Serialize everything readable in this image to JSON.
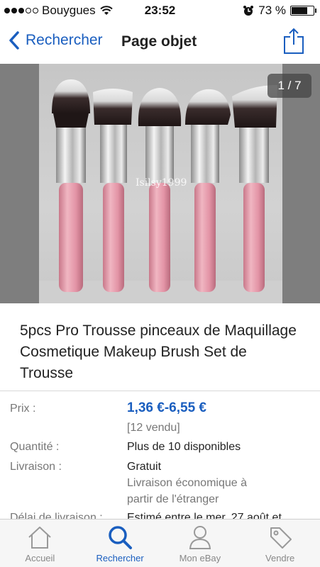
{
  "status_bar": {
    "carrier": "Bouygues",
    "time": "23:52",
    "battery_text": "73 %",
    "battery_level": 0.73
  },
  "nav": {
    "back_label": "Rechercher",
    "title": "Page objet",
    "share_icon": "share-icon"
  },
  "gallery": {
    "counter": "1 / 7",
    "watermark": "Isilsy1999"
  },
  "item": {
    "title": "5pcs Pro Trousse pinceaux de Maquillage Cosmetique Makeup Brush Set de Trousse"
  },
  "details": {
    "price_label": "Prix :",
    "price_value": "1,36 €-6,55 €",
    "sold": "[12 vendu]",
    "quantity_label": "Quantité :",
    "quantity_value": "Plus de 10 disponibles",
    "delivery_label": "Livraison :",
    "delivery_value": "Gratuit",
    "delivery_line2": "Livraison économique à",
    "delivery_line3": "partir de l'étranger",
    "delay_label": "Délai de livraison :",
    "delay_value": "Estimé entre le mer. 27 août et"
  },
  "tabs": [
    {
      "label": "Accueil",
      "icon": "home-icon"
    },
    {
      "label": "Rechercher",
      "icon": "search-icon",
      "active": true
    },
    {
      "label": "Mon eBay",
      "icon": "person-icon"
    },
    {
      "label": "Vendre",
      "icon": "tag-icon"
    }
  ],
  "colors": {
    "accent": "#1a5ebf",
    "brush_handle": "#e39aa8"
  }
}
